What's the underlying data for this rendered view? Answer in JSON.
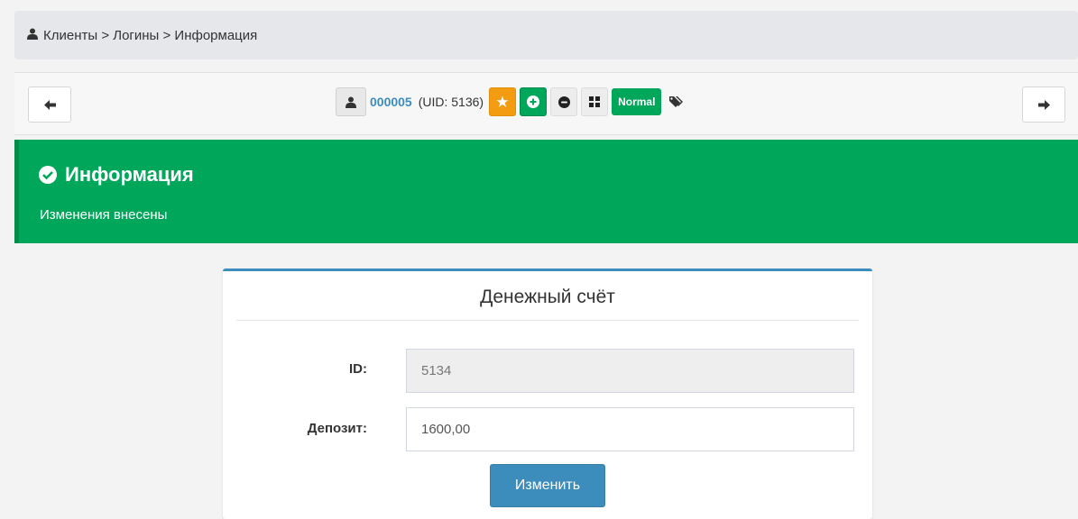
{
  "breadcrumb": {
    "text": "Клиенты > Логины > Информация"
  },
  "toolbar": {
    "login_number": "000005",
    "uid_text": "(UID: 5136)",
    "status_badge": "Normal"
  },
  "alert": {
    "title": "Информация",
    "message": "Изменения внесены",
    "color": "#00a65a"
  },
  "panel": {
    "title": "Денежный счёт",
    "fields": [
      {
        "label": "ID:",
        "value": "5134",
        "readonly": true
      },
      {
        "label": "Депозит:",
        "value": "1600,00",
        "readonly": false
      }
    ],
    "submit_label": "Изменить"
  },
  "icons": {
    "breadcrumb": "user-icon",
    "prev": "arrow-left-icon",
    "next": "arrow-right-icon",
    "actions": [
      "user-icon",
      "star-icon",
      "plus-circle-icon",
      "minus-circle-icon",
      "grid-icon",
      "tags-icon"
    ],
    "alert": "check-circle-icon"
  },
  "colors": {
    "primary": "#3c8dbc",
    "success": "#00a65a",
    "warning": "#f39c12"
  }
}
